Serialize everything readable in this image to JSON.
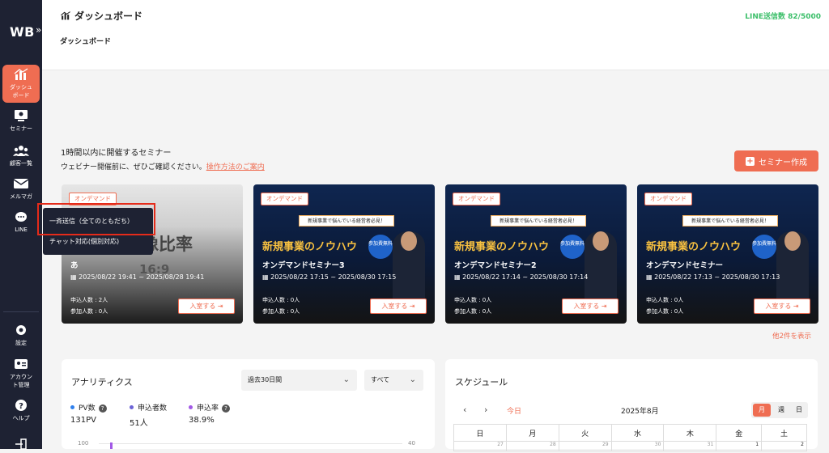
{
  "sidebar": {
    "logo": "WB",
    "items": [
      {
        "label": "ダッシュ\nボード",
        "icon": "chart-icon"
      },
      {
        "label": "セミナー",
        "icon": "monitor-icon"
      },
      {
        "label": "顧客一覧",
        "icon": "users-icon"
      },
      {
        "label": "メルマガ",
        "icon": "mail-icon"
      },
      {
        "label": "LINE",
        "icon": "chat-icon"
      },
      {
        "label": "設定",
        "icon": "gear-icon"
      },
      {
        "label": "アカウン\nト管理",
        "icon": "id-card-icon"
      },
      {
        "label": "ヘルプ",
        "icon": "help-icon"
      }
    ]
  },
  "header": {
    "title": "ダッシュボード",
    "subtitle": "ダッシュボード",
    "line_quota": "LINE送信数 82/5000"
  },
  "seminars": {
    "title": "1時間以内に開催するセミナー",
    "desc": "ウェビナー開催前に、ぜひご確認ください。",
    "link": "操作方法のご案内",
    "create_button": "セミナー作成",
    "more_link": "他2件を表示",
    "cards": [
      {
        "tag": "オンデマンド",
        "image_text": "像比率",
        "image_text2": "16:9",
        "title": "あ",
        "date": "2025/08/22 19:41 ~ 2025/08/28 19:41",
        "applicants": "申込人数 : 2人",
        "participants": "参加人数 : 0人",
        "enter": "入室する"
      },
      {
        "tag": "オンデマンド",
        "promo": "新規事業で悩んでいる経営者必見！",
        "headline": "新規事業のノウハウ",
        "badge": "参加費無料",
        "title": "オンデマンドセミナー3",
        "date": "2025/08/22 17:15 ~ 2025/08/30 17:15",
        "applicants": "申込人数 : 0人",
        "participants": "参加人数 : 0人",
        "enter": "入室する"
      },
      {
        "tag": "オンデマンド",
        "promo": "新規事業で悩んでいる経営者必見！",
        "headline": "新規事業のノウハウ",
        "badge": "参加費無料",
        "title": "オンデマンドセミナー2",
        "date": "2025/08/22 17:14 ~ 2025/08/30 17:14",
        "applicants": "申込人数 : 0人",
        "participants": "参加人数 : 0人",
        "enter": "入室する"
      },
      {
        "tag": "オンデマンド",
        "promo": "新規事業で悩んでいる経営者必見！",
        "headline": "新規事業のノウハウ",
        "badge": "参加費無料",
        "title": "オンデマンドセミナー",
        "date": "2025/08/22 17:13 ~ 2025/08/30 17:13",
        "applicants": "申込人数 : 0人",
        "participants": "参加人数 : 0人",
        "enter": "入室する"
      }
    ]
  },
  "line_menu": {
    "broadcast": "一斉送信（全てのともだち）",
    "chat": "チャット対応(個別対応)"
  },
  "analytics": {
    "title": "アナリティクス",
    "period": "過去30日間",
    "filter": "すべて",
    "stats": [
      {
        "label": "PV数",
        "value": "131PV",
        "color": "#2f80ed"
      },
      {
        "label": "申込者数",
        "value": "51人",
        "color": "#6c63d6"
      },
      {
        "label": "申込率",
        "value": "38.9%",
        "color": "#a259e6"
      }
    ],
    "y_left_top": "100",
    "y_right_top": "40"
  },
  "schedule": {
    "title": "スケジュール",
    "today": "今日",
    "month": "2025年8月",
    "views": [
      "月",
      "週",
      "日"
    ],
    "weekdays": [
      "日",
      "月",
      "火",
      "水",
      "木",
      "金",
      "土"
    ],
    "first_row": [
      "27",
      "28",
      "29",
      "30",
      "31",
      "1",
      "2"
    ]
  }
}
